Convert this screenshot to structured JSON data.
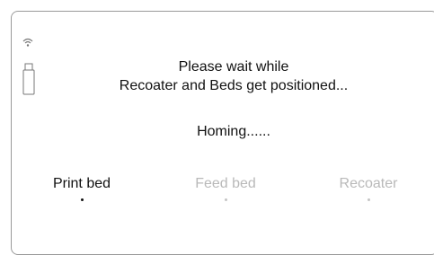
{
  "message": {
    "line1": "Please wait while",
    "line2": "Recoater and Beds get positioned..."
  },
  "status": "Homing......",
  "indicators": {
    "wifi_icon": "wifi-icon",
    "usb_icon": "usb-drive-icon"
  },
  "steps": [
    {
      "label": "Print bed",
      "state": "active"
    },
    {
      "label": "Feed bed",
      "state": "inactive"
    },
    {
      "label": "Recoater",
      "state": "inactive"
    }
  ],
  "colors": {
    "active": "#111111",
    "inactive": "#b9b9b9",
    "border": "#9a9a9a"
  }
}
